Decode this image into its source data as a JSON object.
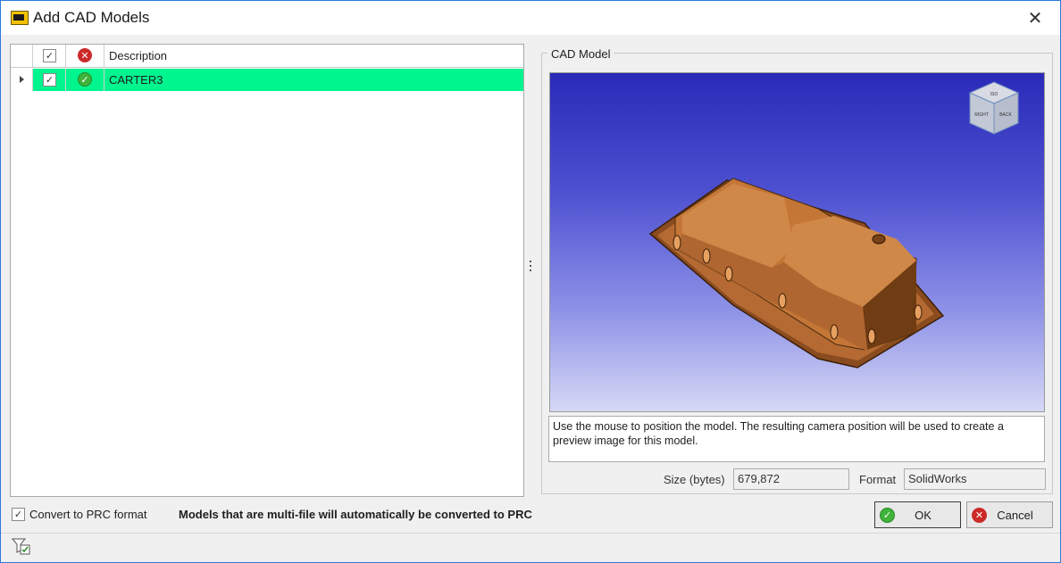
{
  "window": {
    "title": "Add CAD Models",
    "close_glyph": "✕"
  },
  "grid": {
    "header": {
      "check_glyph": "✓",
      "status_glyph": "✕",
      "description": "Description"
    },
    "rows": [
      {
        "checked_glyph": "✓",
        "status_glyph": "✓",
        "description": "CARTER3",
        "row_color": "#00f58f"
      }
    ]
  },
  "cad_model": {
    "group_title": "CAD Model",
    "hint": "Use the mouse to position the model. The resulting camera position will be used to create a preview image for this model.",
    "size_label": "Size (bytes)",
    "size_value": "679,872",
    "format_label": "Format",
    "format_value": "SolidWorks",
    "viewcube_faces": [
      "ISO",
      "RIGHT",
      "BACK"
    ]
  },
  "bottom": {
    "convert_check_glyph": "✓",
    "convert_label": "Convert to PRC format",
    "note": "Models that are multi-file will automatically be converted to PRC",
    "ok_label": "OK",
    "cancel_label": "Cancel"
  },
  "colors": {
    "accent": "#2b79d8",
    "row_highlight": "#00f58f",
    "model": "#c87a3c"
  }
}
